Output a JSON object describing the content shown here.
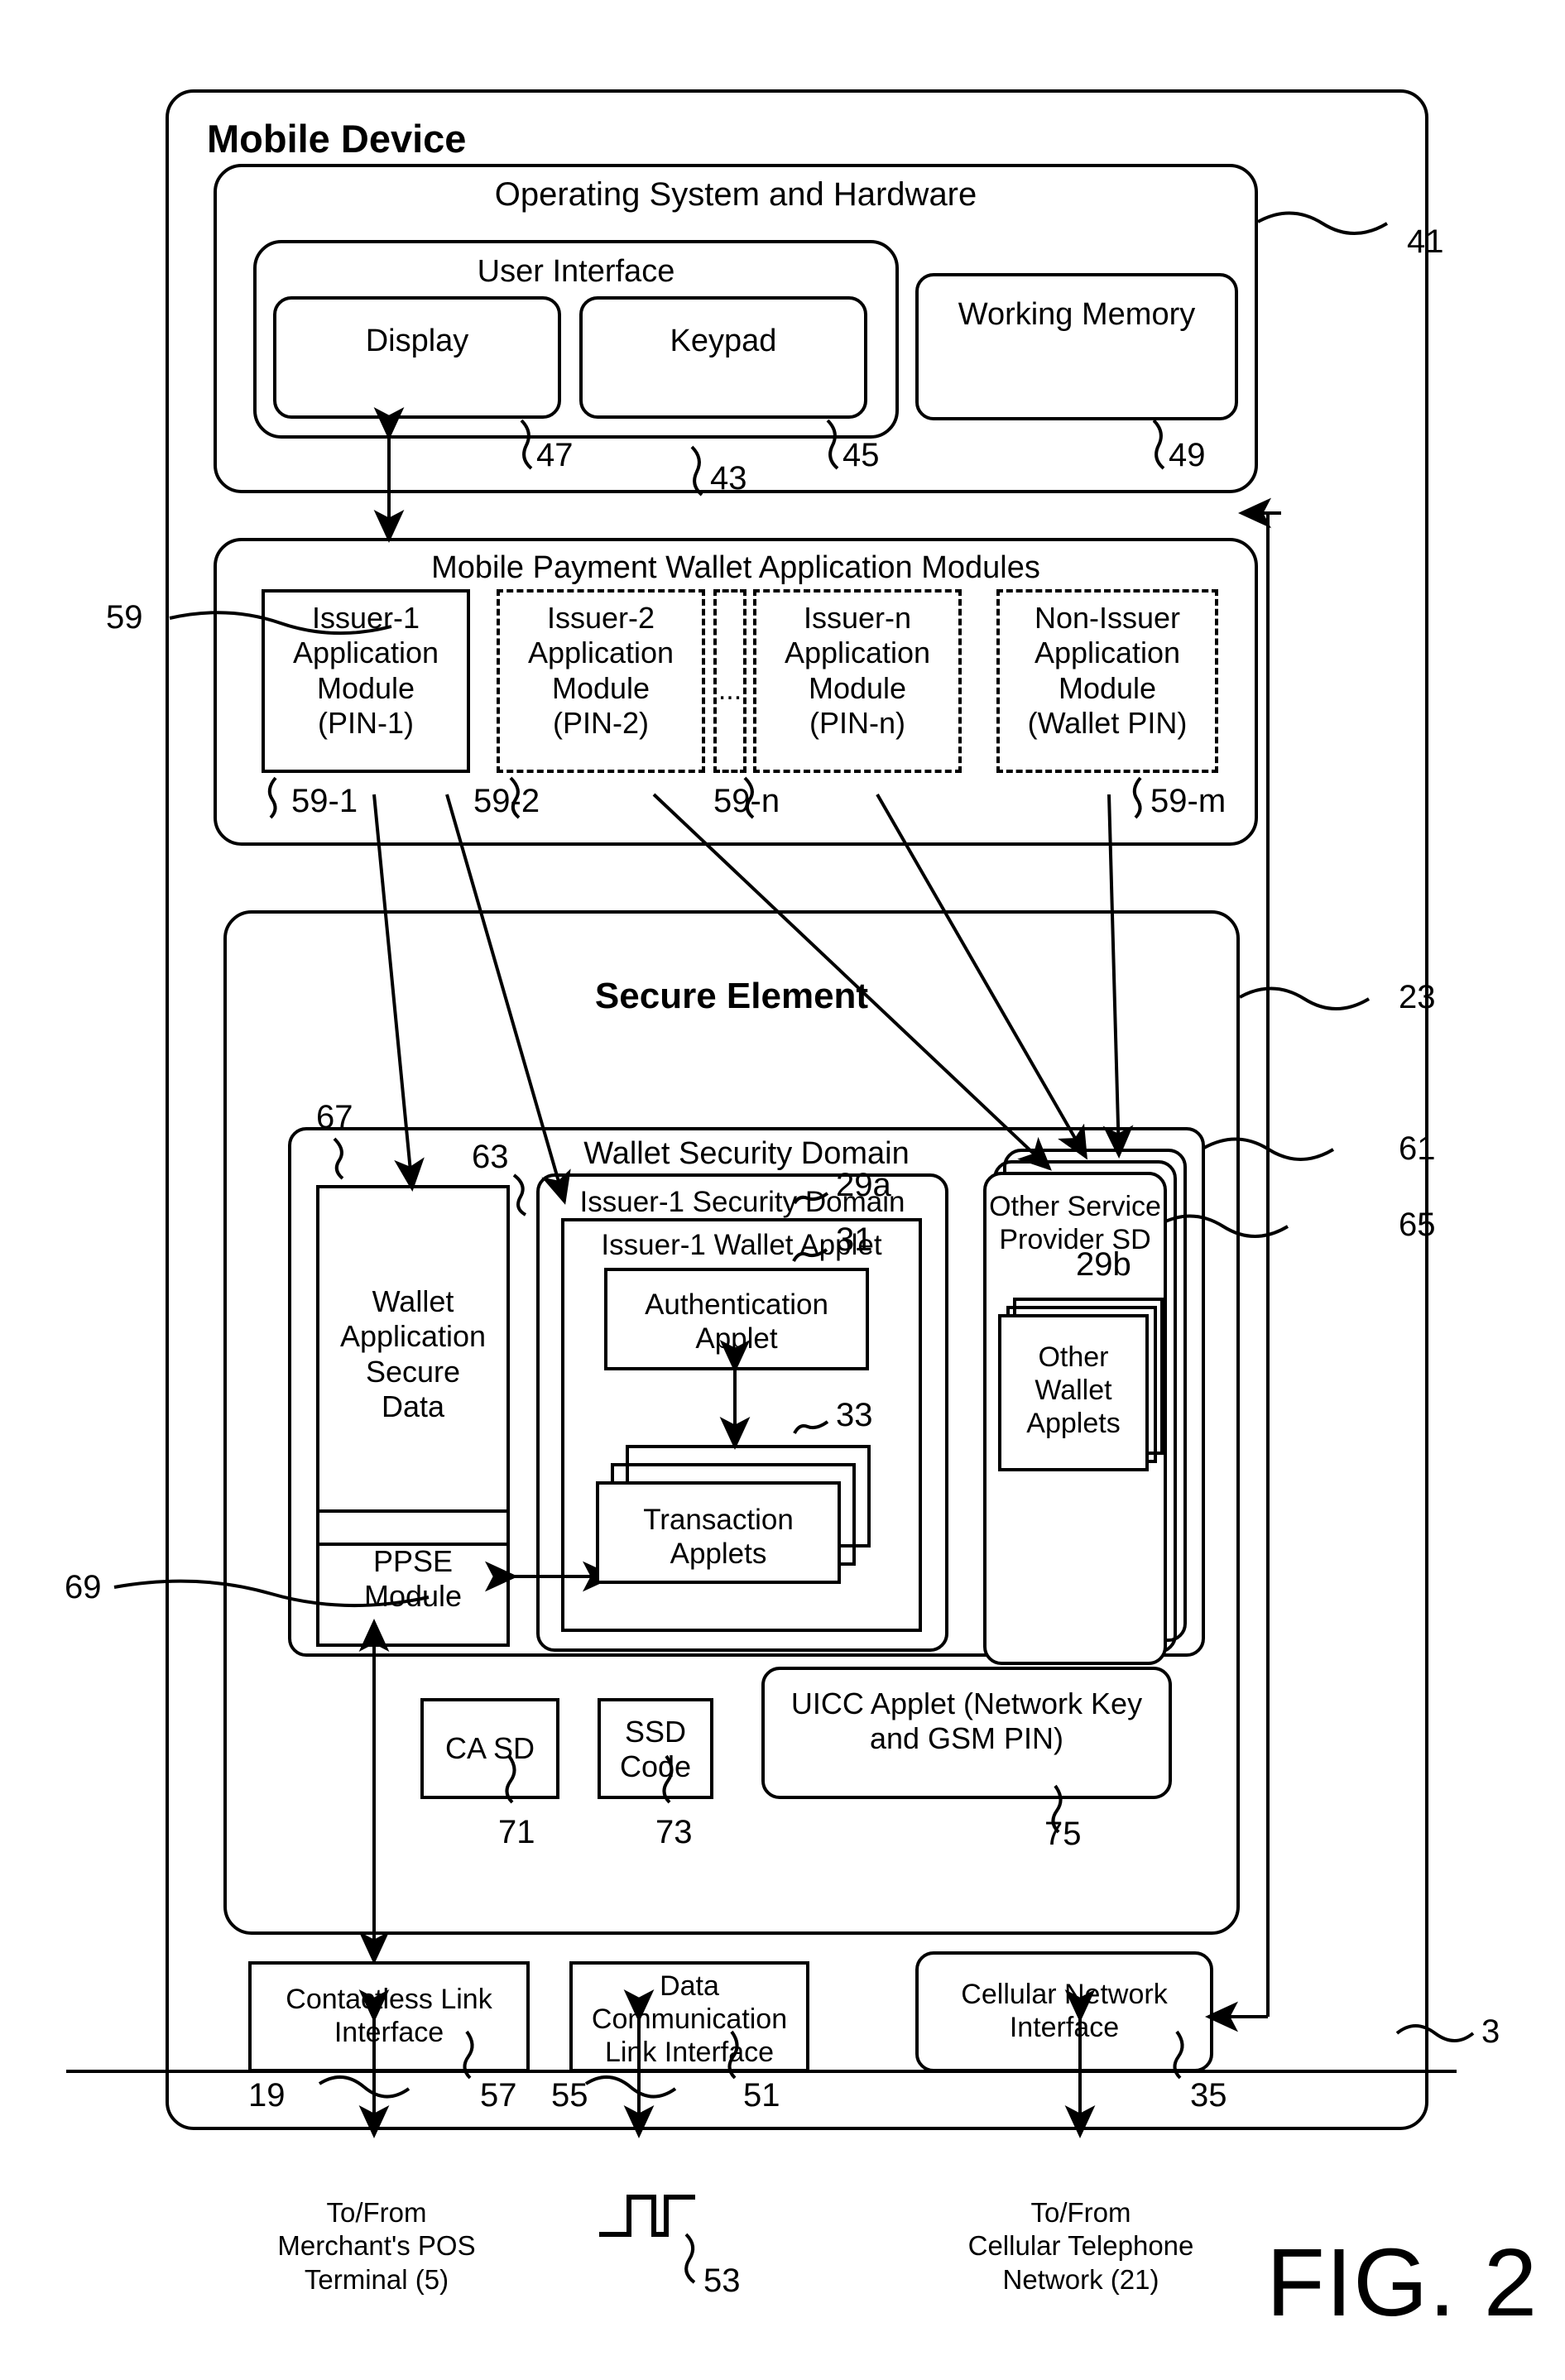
{
  "figure": {
    "label": "FIG. 2",
    "type": "patent-block-diagram"
  },
  "diagram": {
    "outer": {
      "title": "Mobile Device",
      "ref": "3"
    },
    "os_hardware": {
      "title": "Operating System and Hardware",
      "ref": "41"
    },
    "user_interface": {
      "title": "User Interface",
      "ref": "43",
      "children": [
        {
          "label": "Display",
          "ref": "47"
        },
        {
          "label": "Keypad",
          "ref": "45"
        }
      ]
    },
    "working_memory": {
      "label": "Working Memory",
      "ref": "49"
    },
    "wallet_app_modules": {
      "title": "Mobile Payment Wallet Application Modules",
      "ref": "59",
      "ellipsis": "...",
      "modules": [
        {
          "label": "Issuer-1\nApplication\nModule\n(PIN-1)",
          "ref": "59-1",
          "style": "solid"
        },
        {
          "label": "Issuer-2\nApplication\nModule\n(PIN-2)",
          "ref": "59-2",
          "style": "dashed"
        },
        {
          "label": "Issuer-n\nApplication\nModule\n(PIN-n)",
          "ref": "59-n",
          "style": "dashed"
        },
        {
          "label": "Non-Issuer\nApplication\nModule\n(Wallet PIN)",
          "ref": "59-m",
          "style": "dashed"
        }
      ]
    },
    "secure_element": {
      "title": "Secure Element",
      "ref": "23"
    },
    "wallet_security_domain": {
      "title": "Wallet Security Domain",
      "ref": "61",
      "wallet_secure_data": {
        "label": "Wallet\nApplication\nSecure\nData",
        "ref": "67"
      },
      "ppse_module": {
        "label": "PPSE\nModule",
        "ref": "69"
      },
      "issuer1_security_domain": {
        "title": "Issuer-1 Security Domain",
        "ref": "63",
        "wallet_applet": {
          "title": "Issuer-1 Wallet Applet",
          "ref": "29a",
          "authentication_applet": {
            "label": "Authentication\nApplet",
            "ref": "31"
          },
          "transaction_applets": {
            "label": "Transaction\nApplets",
            "ref": "33"
          }
        }
      },
      "other_service_provider_sd": {
        "title": "Other Service\nProvider SD",
        "ref": "65",
        "other_wallet_applets": {
          "label": "Other\nWallet\nApplets",
          "ref": "29b"
        }
      }
    },
    "se_extras": [
      {
        "label": "CA SD",
        "ref": "71"
      },
      {
        "label": "SSD\nCode",
        "ref": "73"
      },
      {
        "label": "UICC Applet (Network Key\nand GSM PIN)",
        "ref": "75"
      }
    ],
    "interfaces": [
      {
        "label": "Contactless Link\nInterface",
        "ref": "57",
        "link_ref": "19",
        "external": "To/From\nMerchant's POS\nTerminal (5)"
      },
      {
        "label": "Data\nCommunication\nLink Interface",
        "ref": "51",
        "link_ref": "55",
        "signal_ref": "53",
        "external": ""
      },
      {
        "label": "Cellular Network\nInterface",
        "ref": "35",
        "link_ref": "",
        "external": "To/From\nCellular Telephone\nNetwork (21)"
      }
    ]
  },
  "colors": {
    "line": "#000000",
    "background": "#ffffff"
  }
}
